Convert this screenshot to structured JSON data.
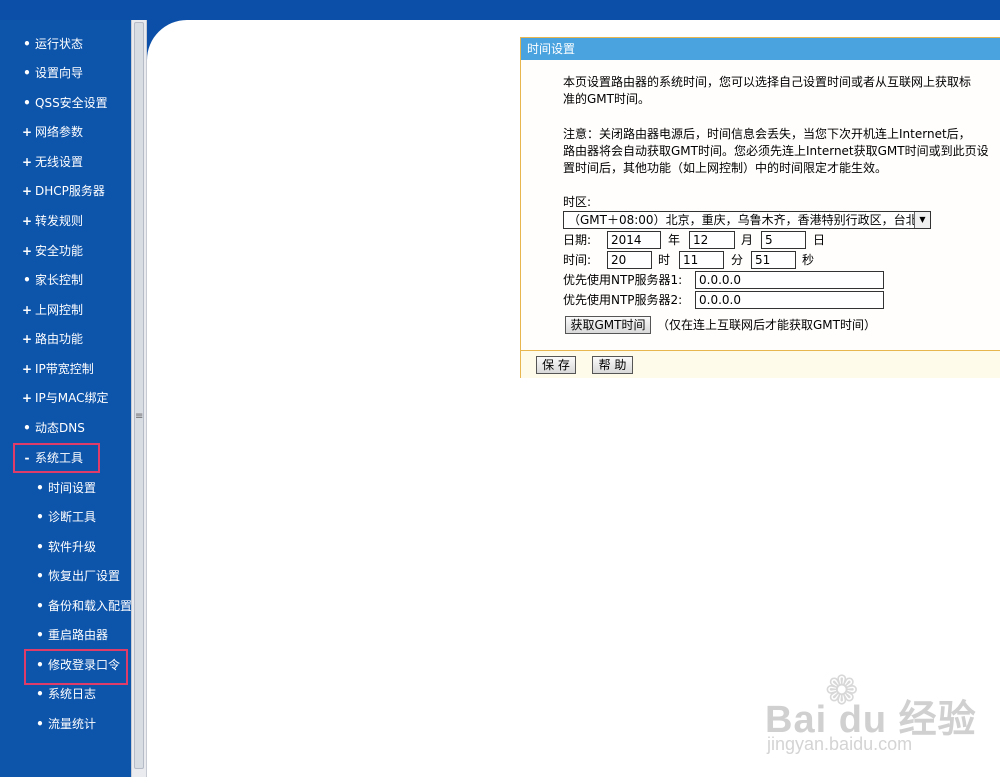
{
  "sidebar": {
    "items": [
      {
        "label": "运行状态",
        "bullet": "•"
      },
      {
        "label": "设置向导",
        "bullet": "•"
      },
      {
        "label": "QSS安全设置",
        "bullet": "•"
      },
      {
        "label": "网络参数",
        "bullet": "+"
      },
      {
        "label": "无线设置",
        "bullet": "+"
      },
      {
        "label": "DHCP服务器",
        "bullet": "+"
      },
      {
        "label": "转发规则",
        "bullet": "+"
      },
      {
        "label": "安全功能",
        "bullet": "+"
      },
      {
        "label": "家长控制",
        "bullet": "•"
      },
      {
        "label": "上网控制",
        "bullet": "+"
      },
      {
        "label": "路由功能",
        "bullet": "+"
      },
      {
        "label": "IP带宽控制",
        "bullet": "+"
      },
      {
        "label": "IP与MAC绑定",
        "bullet": "+"
      },
      {
        "label": "动态DNS",
        "bullet": "•"
      },
      {
        "label": "系统工具",
        "bullet": "-"
      }
    ],
    "sub_items": [
      {
        "label": "时间设置",
        "bullet": "•"
      },
      {
        "label": "诊断工具",
        "bullet": "•"
      },
      {
        "label": "软件升级",
        "bullet": "•"
      },
      {
        "label": "恢复出厂设置",
        "bullet": "•"
      },
      {
        "label": "备份和载入配置",
        "bullet": "•"
      },
      {
        "label": "重启路由器",
        "bullet": "•"
      },
      {
        "label": "修改登录口令",
        "bullet": "•"
      },
      {
        "label": "系统日志",
        "bullet": "•"
      },
      {
        "label": "流量统计",
        "bullet": "•"
      }
    ]
  },
  "scrollbar": {
    "grip": "≡"
  },
  "panel": {
    "title": "时间设置",
    "intro_line1": "本页设置路由器的系统时间，您可以选择自己设置时间或者从互联网上获取标",
    "intro_line2": "准的GMT时间。",
    "note_line1": "注意：关闭路由器电源后，时间信息会丢失，当您下次开机连上Internet后，",
    "note_line2": "路由器将会自动获取GMT时间。您必须先连上Internet获取GMT时间或到此页设",
    "note_line3": "置时间后，其他功能（如上网控制）中的时间限定才能生效。",
    "timezone_label": "时区:",
    "timezone_value": "（GMT＋08:00）北京，重庆，乌鲁木齐，香港特别行政区，台北",
    "timezone_arrow": "▼",
    "date_label": "日期:",
    "year_value": "2014",
    "year_unit": "年",
    "month_value": "12",
    "month_unit": "月",
    "day_value": "5",
    "day_unit": "日",
    "time_label": "时间:",
    "hour_value": "20",
    "hour_unit": "时",
    "minute_value": "11",
    "minute_unit": "分",
    "second_value": "51",
    "second_unit": "秒",
    "ntp1_label": "优先使用NTP服务器1:",
    "ntp1_value": "0.0.0.0",
    "ntp2_label": "优先使用NTP服务器2:",
    "ntp2_value": "0.0.0.0",
    "get_gmt_button": "获取GMT时间",
    "get_gmt_hint": "（仅在连上互联网后才能获取GMT时间）",
    "save_button": "保 存",
    "help_button": "帮 助"
  },
  "watermark": {
    "brand": "Bai du 经验",
    "url": "jingyan.baidu.com",
    "paw": "❁"
  },
  "colors": {
    "sidebar": "#0d54ab",
    "panel_title": "#4aa3df",
    "highlight": "#e03c6a",
    "panel_border": "#e8b64f"
  }
}
